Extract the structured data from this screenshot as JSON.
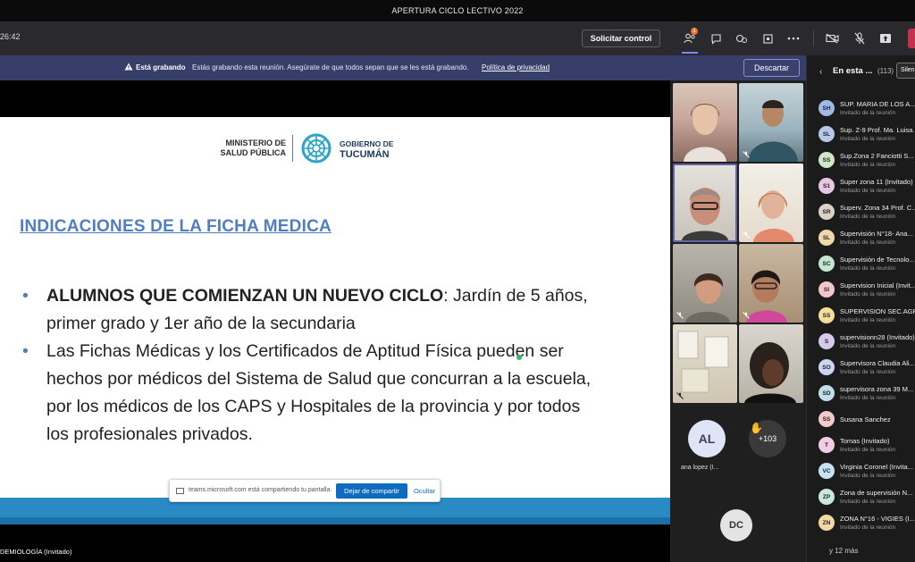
{
  "window": {
    "title": "APERTURA CICLO LECTIVO 2022"
  },
  "toolbar": {
    "timer": "26:42",
    "request_control": "Solicitar control",
    "people_badge": "1",
    "icons": [
      "people-icon",
      "chat-icon",
      "reactions-icon",
      "rooms-icon",
      "more-icon",
      "camera-off-icon",
      "mic-off-icon",
      "share-tray-icon"
    ]
  },
  "recording": {
    "strong": "Está grabando",
    "text": "Estás grabando esta reunión. Asegúrate de que todos sepan que se les está grabando.",
    "link": "Política de privacidad",
    "dismiss": "Descartar"
  },
  "slide": {
    "logo_left_1": "MINISTERIO DE",
    "logo_left_2": "SALUD PÚBLICA",
    "logo_right_1": "GOBIERNO DE",
    "logo_right_2": "TUCUMÁN",
    "title": "INDICACIONES DE LA FICHA MEDICA",
    "bullet1_bold": "ALUMNOS QUE COMIENZAN UN NUEVO CICLO",
    "bullet1_text": ": Jardín de 5 años, primer grado y 1er año de la secundaria",
    "bullet2_text": "Las Fichas Médicas y los Certificados de Aptitud Física pueden ser hechos por médicos del Sistema de Salud que concurran a la escuela, por los médicos de los CAPS y Hospitales de la provincia y por todos los profesionales privados."
  },
  "share_bar": {
    "text": "teams.microsoft.com está compartiendo tu pantalla.",
    "stop": "Dejar de compartir",
    "hide": "Ocultar"
  },
  "presenter": {
    "name": "DEMIOLOGÍA (Invitado)"
  },
  "video": {
    "al_initials": "AL",
    "al_name": "ana lopez (I...",
    "overflow": "+103",
    "dc_initials": "DC"
  },
  "panel": {
    "title": "En esta ...",
    "count": "(113)",
    "mute_all": "Silenciar",
    "more": "y 12 más",
    "participants": [
      {
        "initials": "SH",
        "name": "SUP. MARIA DE LOS A...",
        "sub": "Invitado de la reunión",
        "color": "#9fb8e8"
      },
      {
        "initials": "SL",
        "name": "Sup. Z-9 Prof. Ma. Luisa...",
        "sub": "Invitado de la reunión",
        "color": "#b7c7e8"
      },
      {
        "initials": "SS",
        "name": "Sup.Zona 2 Fanciotti S...",
        "sub": "Invitado de la reunión",
        "color": "#cfe7c4"
      },
      {
        "initials": "S1",
        "name": "Super zona 11 (Invitado)",
        "sub": "Invitado de la reunión",
        "color": "#e8c7e3"
      },
      {
        "initials": "SR",
        "name": "Superv. Zona 34 Prof. C...",
        "sub": "Invitado de la reunión",
        "color": "#dad2c4"
      },
      {
        "initials": "SL",
        "name": "Supervisión N°18- Ana...",
        "sub": "Invitado de la reunión",
        "color": "#f0d9a8"
      },
      {
        "initials": "SC",
        "name": "Supervisión de Tecnolo...",
        "sub": "Invitado de la reunión",
        "color": "#c3e6cf"
      },
      {
        "initials": "SI",
        "name": "Supervision Inicial (Invit...",
        "sub": "Invitado de la reunión",
        "color": "#f2c6cf"
      },
      {
        "initials": "SS",
        "name": "SUPERVISION SEC.AGR...",
        "sub": "Invitado de la reunión",
        "color": "#f3de9c"
      },
      {
        "initials": "S",
        "name": "supervisionn28 (Invitado)",
        "sub": "Invitado de la reunión",
        "color": "#d6c9ea"
      },
      {
        "initials": "SO",
        "name": "Supervisora Claudia Ali...",
        "sub": "Invitado de la reunión",
        "color": "#cbd6f1"
      },
      {
        "initials": "SD",
        "name": "supervisora zona 39 M...",
        "sub": "Invitado de la reunión",
        "color": "#bfe0ea"
      },
      {
        "initials": "SS",
        "name": "Susana Sanchez",
        "sub": "",
        "color": "#f4c9c9"
      },
      {
        "initials": "T",
        "name": "Tomas (Invitado)",
        "sub": "Invitado de la reunión",
        "color": "#f0cde6"
      },
      {
        "initials": "VC",
        "name": "Virginia Coronel (Invita...",
        "sub": "Invitado de la reunión",
        "color": "#c5e3f4"
      },
      {
        "initials": "ZP",
        "name": "Zona de supervisión N...",
        "sub": "Invitado de la reunión",
        "color": "#c8e8e0"
      },
      {
        "initials": "ZN",
        "name": "ZONA N°16 - VIGIES (I...",
        "sub": "Invitado de la reunión",
        "color": "#f1d8a4"
      }
    ]
  }
}
